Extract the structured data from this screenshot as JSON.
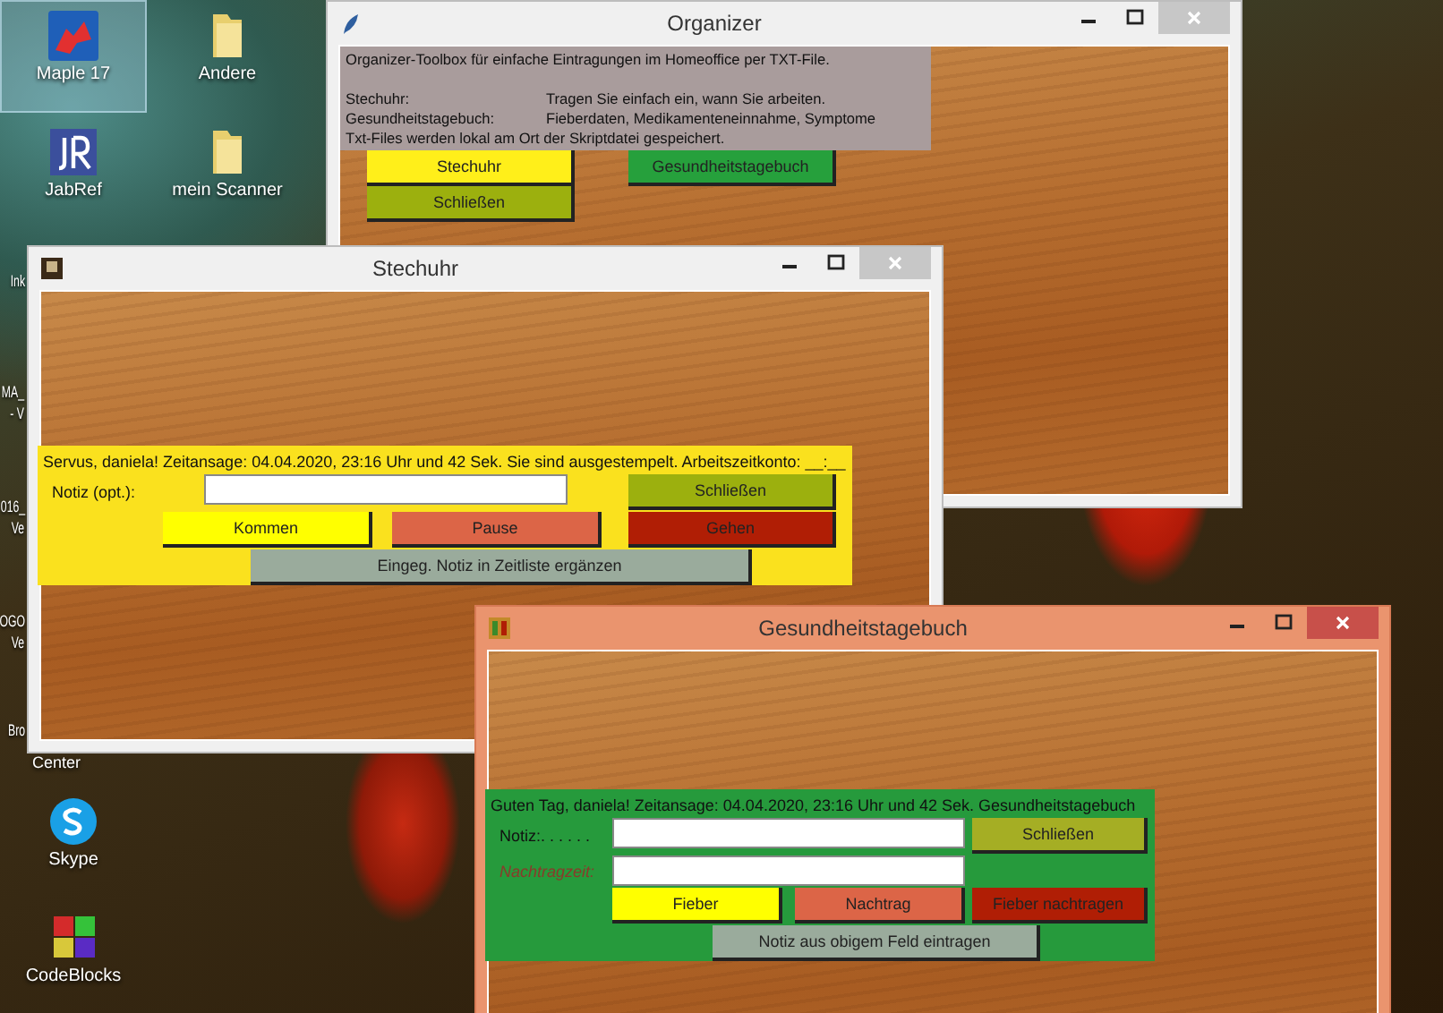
{
  "desktop": {
    "icons": [
      {
        "label": "Maple 17",
        "kind": "maple",
        "selected": true
      },
      {
        "label": "Andere",
        "kind": "folder",
        "selected": false
      },
      {
        "label": "JabRef",
        "kind": "jabref",
        "selected": false
      },
      {
        "label": "mein Scanner",
        "kind": "folder",
        "selected": false
      },
      {
        "label": "Skype",
        "kind": "skype",
        "selected": false
      },
      {
        "label": "CodeBlocks",
        "kind": "codeblocks",
        "selected": false
      }
    ],
    "partial_labels": [
      "Ink",
      "MA_",
      "- V",
      "016_",
      "Ve",
      "OGO",
      "Ve",
      "Bro",
      "Center"
    ]
  },
  "windows": [
    {
      "kind": "organizer",
      "title": "Organizer",
      "active": false,
      "info": {
        "intro": "Organizer-Toolbox für einfache Eintragungen im Homeoffice per TXT-File.",
        "rows": [
          {
            "term": "Stechuhr:",
            "text": "Tragen Sie einfach ein, wann Sie arbeiten."
          },
          {
            "term": "Gesundheitstagebuch:",
            "text": "Fieberdaten, Medikamenteneinnahme, Symptome"
          }
        ],
        "footer": "Txt-Files werden lokal am Ort der Skriptdatei gespeichert."
      },
      "buttons": [
        {
          "label": "Stechuhr",
          "color": "#ffef1a"
        },
        {
          "label": "Gesundheitstagebuch",
          "color": "#26a03c"
        },
        {
          "label": "Schließen",
          "color": "#9cb00e"
        }
      ]
    },
    {
      "kind": "stechuhr",
      "title": "Stechuhr",
      "active": false,
      "message": "Servus, daniela! Zeitansage: 04.04.2020, 23:16 Uhr und 42 Sek. Sie sind ausgestempelt. Arbeitszeitkonto: __:__",
      "fields": [
        {
          "label": "Notiz (opt.):",
          "italic": false
        }
      ],
      "buttons": [
        {
          "label": "Schließen",
          "color": "#9cb00e"
        },
        {
          "label": "Kommen",
          "color": "#ffff00"
        },
        {
          "label": "Pause",
          "color": "#dc6547"
        },
        {
          "label": "Gehen",
          "color": "#b01e05"
        },
        {
          "label": "Eingeg. Notiz in Zeitliste ergänzen",
          "color": "#9aab9c"
        }
      ]
    },
    {
      "kind": "gesundheit",
      "title": "Gesundheitstagebuch",
      "active": true,
      "message": "Guten Tag, daniela! Zeitansage: 04.04.2020, 23:16 Uhr und 42 Sek. Gesundheitstagebuch",
      "fields": [
        {
          "label": "Notiz:. . . . . .",
          "italic": false
        },
        {
          "label": "Nachtragzeit:",
          "italic": true
        }
      ],
      "buttons": [
        {
          "label": "Schließen",
          "color": "#a5ae24"
        },
        {
          "label": "Fieber",
          "color": "#ffff00"
        },
        {
          "label": "Nachtrag",
          "color": "#dc6547"
        },
        {
          "label": "Fieber nachtragen",
          "color": "#b01e05"
        },
        {
          "label": "Notiz aus obigem Feld eintragen",
          "color": "#9aab9c"
        }
      ]
    }
  ]
}
